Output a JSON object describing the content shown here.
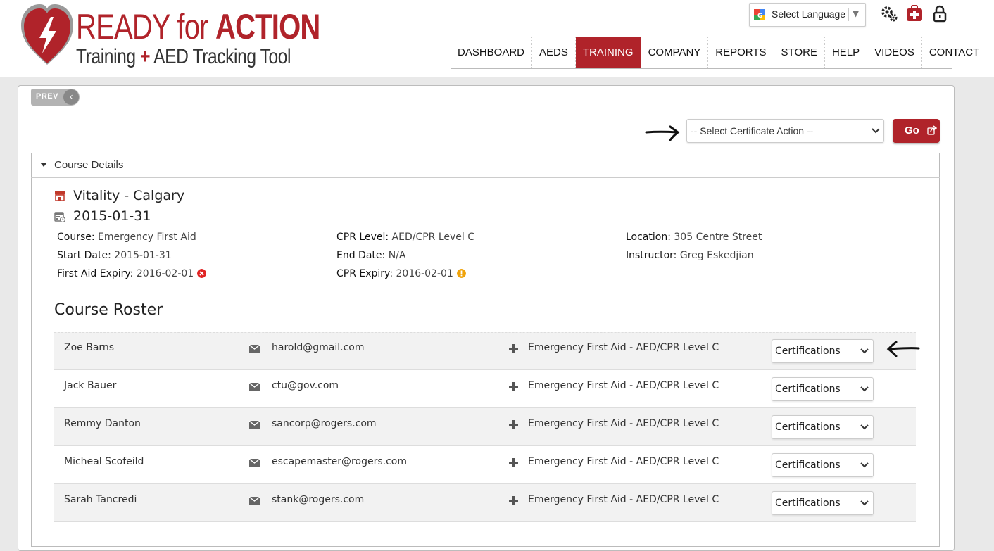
{
  "brand": {
    "title_part1": "READY for ",
    "title_part2": "ACTION",
    "subtitle_part1": "Training ",
    "subtitle_plus": "+",
    "subtitle_part2": " AED Tracking Tool",
    "accent_color": "#b0232a"
  },
  "language": {
    "label": "Select Language",
    "arrow": "▼"
  },
  "top_icons": [
    "gears-icon",
    "first-aid-kit-icon",
    "lock-icon"
  ],
  "nav": {
    "items": [
      {
        "label": "DASHBOARD",
        "active": false
      },
      {
        "label": "AEDS",
        "active": false
      },
      {
        "label": "TRAINING",
        "active": true
      },
      {
        "label": "COMPANY",
        "active": false
      },
      {
        "label": "REPORTS",
        "active": false
      },
      {
        "label": "STORE",
        "active": false
      },
      {
        "label": "HELP",
        "active": false
      },
      {
        "label": "VIDEOS",
        "active": false
      },
      {
        "label": "CONTACT",
        "active": false
      }
    ]
  },
  "prev_button": {
    "label": "PREV"
  },
  "certificate_action": {
    "selected": "-- Select Certificate Action --",
    "go_label": "Go"
  },
  "course_details": {
    "section_title": "Course Details",
    "location_name": "Vitality - Calgary",
    "date": "2015-01-31",
    "course_label": "Course:",
    "course_value": "Emergency First Aid",
    "start_label": "Start Date:",
    "start_value": "2015-01-31",
    "fa_expiry_label": "First Aid Expiry:",
    "fa_expiry_value": "2016-02-01",
    "fa_expiry_status": "expired",
    "cpr_level_label": "CPR Level:",
    "cpr_level_value": "AED/CPR Level C",
    "end_label": "End Date:",
    "end_value": "N/A",
    "cpr_expiry_label": "CPR Expiry:",
    "cpr_expiry_value": "2016-02-01",
    "cpr_expiry_status": "warning",
    "location_label": "Location:",
    "location_value": "305 Centre Street",
    "instructor_label": "Instructor:",
    "instructor_value": "Greg Eskedjian"
  },
  "roster": {
    "title": "Course Roster",
    "rows": [
      {
        "name": "Zoe Barns",
        "email": "harold@gmail.com",
        "course": "Emergency First Aid - AED/CPR Level C",
        "action": "Certifications"
      },
      {
        "name": "Jack Bauer",
        "email": "ctu@gov.com",
        "course": "Emergency First Aid - AED/CPR Level C",
        "action": "Certifications"
      },
      {
        "name": "Remmy Danton",
        "email": "sancorp@rogers.com",
        "course": "Emergency First Aid - AED/CPR Level C",
        "action": "Certifications"
      },
      {
        "name": "Micheal Scofeild",
        "email": "escapemaster@rogers.com",
        "course": "Emergency First Aid - AED/CPR Level C",
        "action": "Certifications"
      },
      {
        "name": "Sarah Tancredi",
        "email": "stank@rogers.com",
        "course": "Emergency First Aid - AED/CPR Level C",
        "action": "Certifications"
      }
    ]
  }
}
